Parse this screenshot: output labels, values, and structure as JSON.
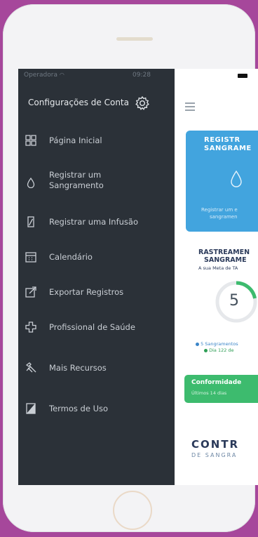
{
  "status_bar": {
    "carrier": "Operadora",
    "time": "09:28"
  },
  "drawer": {
    "title": "Configurações de Conta",
    "items": [
      {
        "label": "Página Inicial",
        "icon": "home-grid-icon"
      },
      {
        "label": "Registrar um\nSangramento",
        "icon": "drop-icon"
      },
      {
        "label": "Registrar uma Infusão",
        "icon": "vial-icon"
      },
      {
        "label": "Calendário",
        "icon": "calendar-icon"
      },
      {
        "label": "Exportar Registros",
        "icon": "export-icon"
      },
      {
        "label": "Profissional de Saúde",
        "icon": "medical-cross-icon"
      },
      {
        "label": "Mais Recursos",
        "icon": "tools-icon"
      },
      {
        "label": "Termos de Uso",
        "icon": "document-icon"
      }
    ]
  },
  "page": {
    "card_bleed": {
      "title_line1": "REGISTR",
      "title_line2": "SANGRAME",
      "sub_line1": "Registrar um e",
      "sub_line2": "sangramen"
    },
    "tracking": {
      "title_line1": "RASTREAMEN",
      "title_line2": "SANGRAME",
      "subtitle": "A sua Meta de TA",
      "count": "5",
      "progress": 0.22,
      "legend_1": "5 Sangramentos",
      "legend_2": "Dia 122 de"
    },
    "compliance": {
      "title": "Conformidade",
      "subtitle": "Últimos 14 dias"
    },
    "logo": {
      "top": "CONTR",
      "bottom": "DE SANGRA"
    }
  },
  "colors": {
    "drawer_bg": "#2b3138",
    "blue_card": "#42a4de",
    "green_card": "#3dbb6e",
    "frame": "#a6479b"
  }
}
